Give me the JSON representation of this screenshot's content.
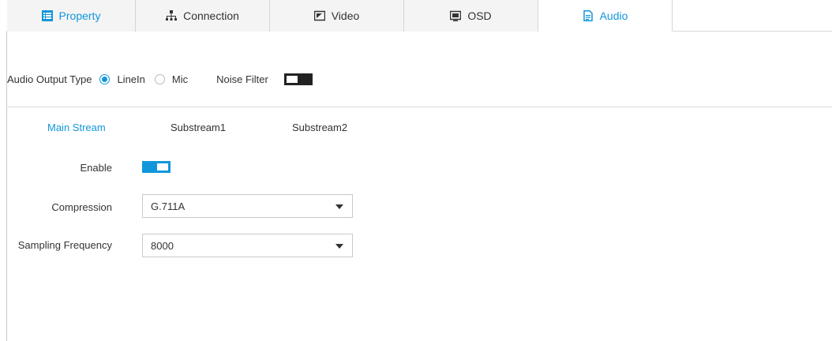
{
  "tabs": [
    {
      "label": "Property",
      "icon": "property-icon",
      "active": false,
      "blue": true
    },
    {
      "label": "Connection",
      "icon": "network-icon",
      "active": false,
      "blue": false
    },
    {
      "label": "Video",
      "icon": "video-icon",
      "active": false,
      "blue": false
    },
    {
      "label": "OSD",
      "icon": "osd-icon",
      "active": false,
      "blue": false
    },
    {
      "label": "Audio",
      "icon": "document-icon",
      "active": true,
      "blue": true
    }
  ],
  "audio_output": {
    "label": "Audio Output Type",
    "options": [
      "LineIn",
      "Mic"
    ],
    "selected": "LineIn"
  },
  "noise_filter": {
    "label": "Noise Filter",
    "enabled": false
  },
  "streams": {
    "items": [
      "Main Stream",
      "Substream1",
      "Substream2"
    ],
    "active": "Main Stream"
  },
  "form": {
    "enable_label": "Enable",
    "enable_on": true,
    "compression_label": "Compression",
    "compression_value": "G.711A",
    "sampling_label": "Sampling Frequency",
    "sampling_value": "8000"
  },
  "colors": {
    "accent": "#1296db",
    "toggle_off": "#222222"
  }
}
